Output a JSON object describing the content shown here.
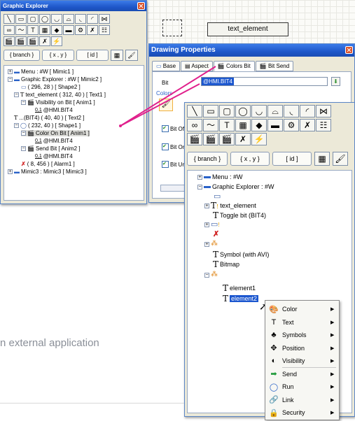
{
  "graphic_explorer": {
    "title": "Graphic Explorer",
    "toolbar_row1": [
      "╲",
      "▭",
      "▢",
      "◯",
      "◡",
      "⌓",
      "◟",
      "◜",
      "⋈"
    ],
    "toolbar_row2": [
      "∞",
      "〜",
      "T",
      "▦",
      "◆",
      "▬",
      "⚙",
      "✗",
      "☷"
    ],
    "toolbar_row3": [
      "🎬",
      "🎬",
      "🎬",
      "✗",
      "⚡"
    ],
    "btn_branch": "{ branch }",
    "btn_xy": "{ x , y }",
    "btn_id": "[ id ]",
    "tree": [
      "Menu : #W [ Mimic1 ]",
      "Graphic Explorer : #W [ Mimic2 ]",
      "( 296, 28 ) [ Shape2 ]",
      "text_element ( 312, 40 ) [ Text1 ]",
      "Visibility on Bit [ Anim1 ]",
      "@HMI.BIT4",
      "...(BIT4) ( 40, 40 ) [ Text2 ]",
      "( 232, 40 ) [ Shape1 ]",
      "Color On Bit [ Anim1 ]",
      "@HMI.BIT4",
      "Send Bit [ Anim2 ]",
      "@HMI.BIT4",
      "( 8, 456 ) [ Alarm1 ]",
      "Mimic3 : Mimic3 [ Mimic3 ]"
    ],
    "tag_prefix": "0,1"
  },
  "canvas": {
    "text_element_label": "text_element"
  },
  "drawing_properties": {
    "title": "Drawing Properties",
    "tabs": [
      "Base",
      "Aspect",
      "Colors Bit",
      "Bit Send"
    ],
    "bit_label": "Bit",
    "bit_value": "@HMI.BIT4",
    "colors_label": "Colors",
    "checkbox_labels": [
      "Bit Of",
      "Bit Or",
      "Bit Ur"
    ]
  },
  "overlay_tree": {
    "btn_branch": "{ branch }",
    "btn_xy": "{ x , y }",
    "btn_id": "[ id ]",
    "toolbar_row1": [
      "╲",
      "▭",
      "▢",
      "◯",
      "◡",
      "⌓",
      "◟",
      "◜",
      "⋈"
    ],
    "toolbar_row2": [
      "∞",
      "〜",
      "T",
      "▦",
      "◆",
      "▬",
      "⚙",
      "✗",
      "☷"
    ],
    "toolbar_row3": [
      "🎬",
      "🎬",
      "🎬",
      "✗",
      "⚡"
    ],
    "items": {
      "menu": "Menu : #W",
      "graphic": "Graphic Explorer : #W",
      "text_element": "text_element",
      "toggle": "Toggle bit (BIT4)",
      "symbol": "Symbol (with AVI)",
      "bitmap": "Bitmap",
      "element1": "element1",
      "element2": "element2"
    }
  },
  "context_menu": {
    "items": [
      {
        "label": "Color",
        "icon": "color-icon"
      },
      {
        "label": "Text",
        "icon": "text-icon"
      },
      {
        "label": "Symbols",
        "icon": "symbols-icon"
      },
      {
        "label": "Position",
        "icon": "position-icon"
      },
      {
        "label": "Visibility",
        "icon": "visibility-icon"
      },
      {
        "label": "Send",
        "icon": "send-icon"
      },
      {
        "label": "Run",
        "icon": "run-icon"
      },
      {
        "label": "Link",
        "icon": "link-icon"
      },
      {
        "label": "Security",
        "icon": "security-icon"
      }
    ]
  },
  "caption": "n external application",
  "colors": {
    "connector": "#e0208c",
    "titlebar": "#1e57c9",
    "selection": "#1c57cf"
  }
}
